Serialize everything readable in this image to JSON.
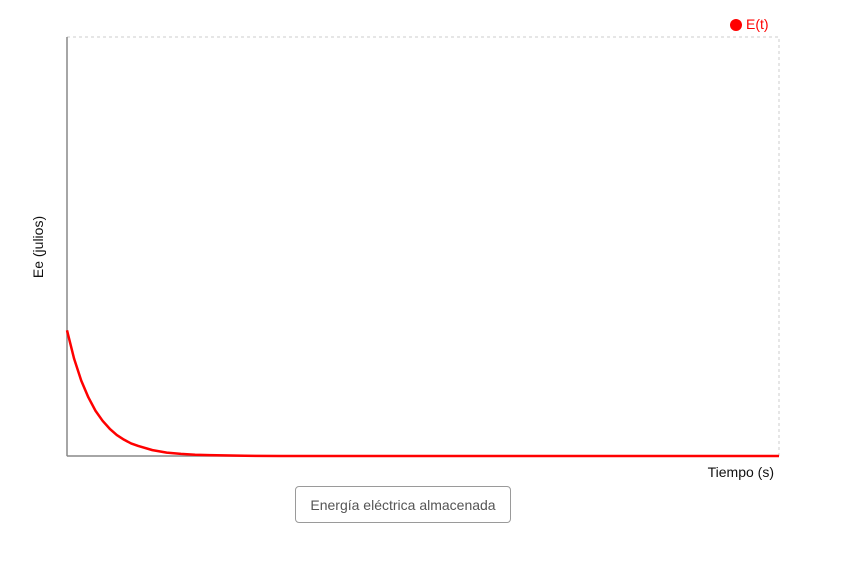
{
  "chart_data": {
    "type": "line",
    "title": "",
    "xlabel": "Tiempo (s)",
    "ylabel": "Ee (julios)",
    "legend": {
      "placement": "top-right"
    },
    "grid": false,
    "xlim": [
      0,
      1
    ],
    "ylim": [
      0,
      1
    ],
    "series": [
      {
        "name": "E(t)",
        "color": "#ff0000",
        "x": [
          0,
          0.01,
          0.02,
          0.03,
          0.04,
          0.05,
          0.06,
          0.07,
          0.08,
          0.09,
          0.1,
          0.12,
          0.14,
          0.16,
          0.18,
          0.2,
          0.25,
          0.3,
          0.4,
          0.5,
          0.6,
          0.7,
          0.8,
          0.9,
          1.0
        ],
        "y": [
          0.3,
          0.232,
          0.18,
          0.14,
          0.108,
          0.084,
          0.065,
          0.05,
          0.039,
          0.03,
          0.024,
          0.014,
          0.008,
          0.005,
          0.003,
          0.002,
          0.0005,
          0.0001,
          0,
          0,
          0,
          0,
          0,
          0,
          0
        ]
      }
    ]
  },
  "controls": {
    "button_label": "Energía eléctrica almacenada"
  }
}
